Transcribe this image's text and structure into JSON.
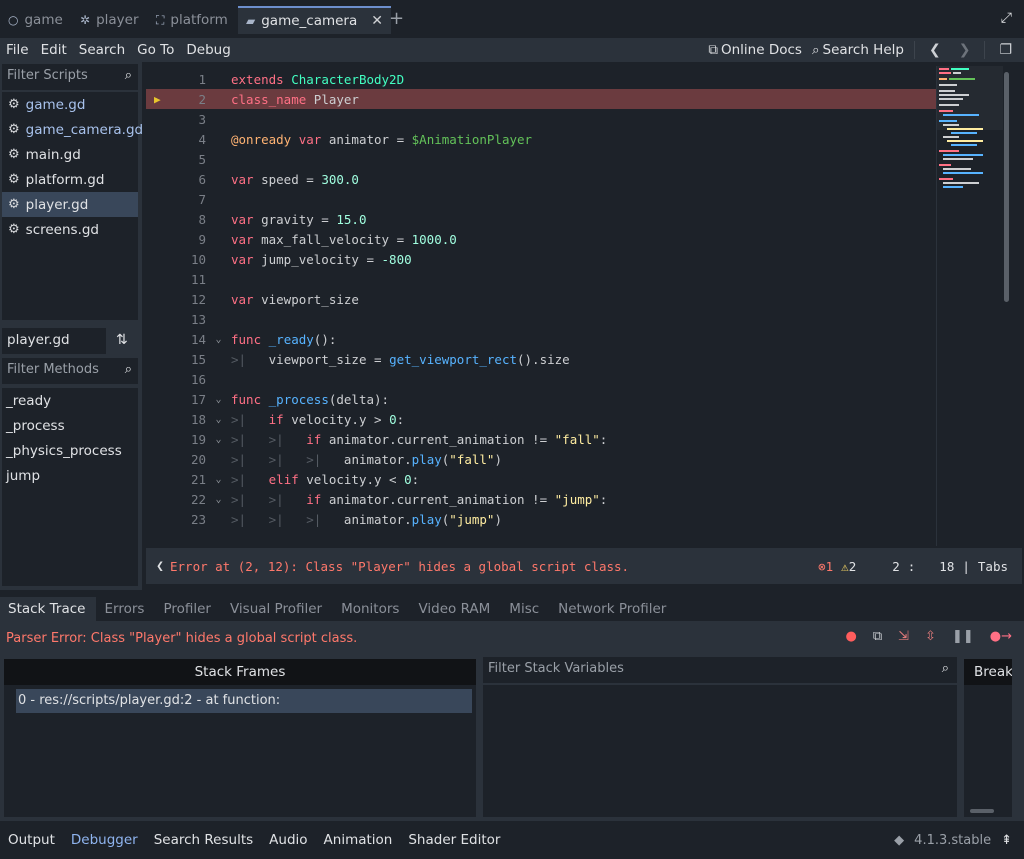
{
  "scene_tabs": [
    {
      "label": "game",
      "icon": "circle-icon"
    },
    {
      "label": "player",
      "icon": "person-icon"
    },
    {
      "label": "platform",
      "icon": "frame-icon"
    },
    {
      "label": "game_camera",
      "icon": "camera-icon"
    }
  ],
  "menu": {
    "items": [
      "File",
      "Edit",
      "Search",
      "Go To",
      "Debug"
    ],
    "online_docs": "Online Docs",
    "search_help": "Search Help"
  },
  "scripts": {
    "filter_placeholder": "Filter Scripts",
    "items": [
      "game.gd",
      "game_camera.gd",
      "main.gd",
      "platform.gd",
      "player.gd",
      "screens.gd"
    ],
    "current": "player.gd"
  },
  "methods": {
    "filter_placeholder": "Filter Methods",
    "items": [
      "_ready",
      "_process",
      "_physics_process",
      "jump"
    ]
  },
  "code_lines": [
    {
      "n": "1",
      "fold": "",
      "html": "<span class=\"kw\">extends</span> <span class=\"ty\">CharacterBody2D</span>"
    },
    {
      "n": "2",
      "fold": "",
      "html": "<span class=\"kw\">class_name</span> Player"
    },
    {
      "n": "3",
      "fold": "",
      "html": ""
    },
    {
      "n": "4",
      "fold": "",
      "html": "<span class=\"an\">@onready</span> <span class=\"kw\">var</span> animator = <span class=\"nd\">$AnimationPlayer</span>"
    },
    {
      "n": "5",
      "fold": "",
      "html": ""
    },
    {
      "n": "6",
      "fold": "",
      "html": "<span class=\"kw\">var</span> speed = <span class=\"num\">300.0</span>"
    },
    {
      "n": "7",
      "fold": "",
      "html": ""
    },
    {
      "n": "8",
      "fold": "",
      "html": "<span class=\"kw\">var</span> gravity = <span class=\"num\">15.0</span>"
    },
    {
      "n": "9",
      "fold": "",
      "html": "<span class=\"kw\">var</span> max_fall_velocity = <span class=\"num\">1000.0</span>"
    },
    {
      "n": "10",
      "fold": "",
      "html": "<span class=\"kw\">var</span> jump_velocity = <span class=\"num\">-800</span>"
    },
    {
      "n": "11",
      "fold": "",
      "html": ""
    },
    {
      "n": "12",
      "fold": "",
      "html": "<span class=\"kw\">var</span> viewport_size"
    },
    {
      "n": "13",
      "fold": "",
      "html": ""
    },
    {
      "n": "14",
      "fold": "v",
      "html": "<span class=\"kw\">func</span> <span class=\"fn\">_ready</span>():"
    },
    {
      "n": "15",
      "fold": "",
      "html": "<span class=\"tabm\">&gt;|</span>   viewport_size = <span class=\"fn\">get_viewport_rect</span>().size"
    },
    {
      "n": "16",
      "fold": "",
      "html": ""
    },
    {
      "n": "17",
      "fold": "v",
      "html": "<span class=\"kw\">func</span> <span class=\"fn\">_process</span>(delta):"
    },
    {
      "n": "18",
      "fold": "v",
      "html": "<span class=\"tabm\">&gt;|</span>   <span class=\"kw\">if</span> velocity.y &gt; <span class=\"num\">0</span>:"
    },
    {
      "n": "19",
      "fold": "v",
      "html": "<span class=\"tabm\">&gt;|</span>   <span class=\"tabm\">&gt;|</span>   <span class=\"kw\">if</span> animator.current_animation != <span class=\"str\">\"fall\"</span>:"
    },
    {
      "n": "20",
      "fold": "",
      "html": "<span class=\"tabm\">&gt;|</span>   <span class=\"tabm\">&gt;|</span>   <span class=\"tabm\">&gt;|</span>   animator.<span class=\"fn\">play</span>(<span class=\"str\">\"fall\"</span>)"
    },
    {
      "n": "21",
      "fold": "v",
      "html": "<span class=\"tabm\">&gt;|</span>   <span class=\"kw\">elif</span> velocity.y &lt; <span class=\"num\">0</span>:"
    },
    {
      "n": "22",
      "fold": "v",
      "html": "<span class=\"tabm\">&gt;|</span>   <span class=\"tabm\">&gt;|</span>   <span class=\"kw\">if</span> animator.current_animation != <span class=\"str\">\"jump\"</span>:"
    },
    {
      "n": "23",
      "fold": "",
      "html": "<span class=\"tabm\">&gt;|</span>   <span class=\"tabm\">&gt;|</span>   <span class=\"tabm\">&gt;|</span>   animator.<span class=\"fn\">play</span>(<span class=\"str\">\"jump\"</span>)"
    }
  ],
  "status": {
    "error": "Error at (2, 12): Class \"Player\" hides a global script class.",
    "error_count": "1",
    "warning_count": "2",
    "line": "2",
    "col_sep": ":",
    "col": "18",
    "indent": "Tabs"
  },
  "debugger": {
    "tabs": [
      "Stack Trace",
      "Errors",
      "Profiler",
      "Visual Profiler",
      "Monitors",
      "Video RAM",
      "Misc",
      "Network Profiler"
    ],
    "parser_error": "Parser Error: Class \"Player\" hides a global script class.",
    "stack_frames_header": "Stack Frames",
    "stack_frame": "0 - res://scripts/player.gd:2 - at function:",
    "filter_vars_placeholder": "Filter Stack Variables",
    "breakpoints_header": "Breakpoints"
  },
  "bottom_bar": {
    "items": [
      "Output",
      "Debugger",
      "Search Results",
      "Audio",
      "Animation",
      "Shader Editor"
    ],
    "version": "4.1.3.stable"
  },
  "colors": {
    "accent": "#6d8fcd",
    "error": "#ff786b",
    "warning": "#ffdd65",
    "error_line_bg": "#6b3b3f"
  }
}
